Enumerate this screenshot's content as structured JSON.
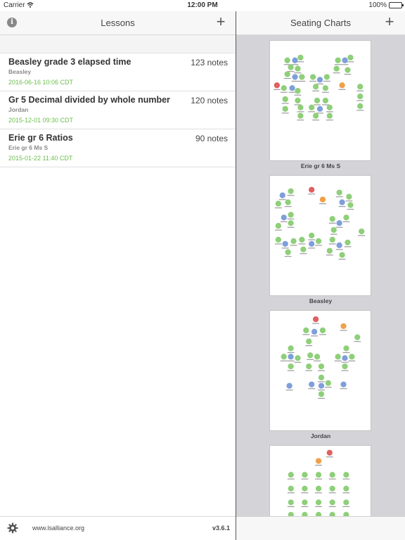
{
  "status": {
    "carrier": "Carrier",
    "time": "12:00 PM",
    "battery": "100%"
  },
  "lessons": {
    "title": "Lessons",
    "items": [
      {
        "title": "Beasley grade 3 elapsed time",
        "subtitle": "Beasley",
        "date": "2016-06-16 10:06 CDT",
        "notes": "123 notes"
      },
      {
        "title": "Gr 5 Decimal divided by whole number",
        "subtitle": "Jordan",
        "date": "2015-12-01 09:30 CDT",
        "notes": "120 notes"
      },
      {
        "title": "Erie gr 6 Ratios",
        "subtitle": "Erie gr 6 Ms S",
        "date": "2015-01-22 11:40 CDT",
        "notes": "90 notes"
      }
    ],
    "footer": {
      "url": "www.lsalliance.org",
      "version": "v3.6.1"
    }
  },
  "seating": {
    "title": "Seating Charts",
    "charts": [
      {
        "label": "Erie gr 6 Ms S"
      },
      {
        "label": "Beasley"
      },
      {
        "label": "Jordan"
      },
      {
        "label": ""
      }
    ]
  },
  "colors": {
    "student": "#8fcf7a",
    "desk": "#7f9fdb",
    "teacher": "#f0a04a",
    "other": "#e06060",
    "accent": "#6abf4b"
  }
}
